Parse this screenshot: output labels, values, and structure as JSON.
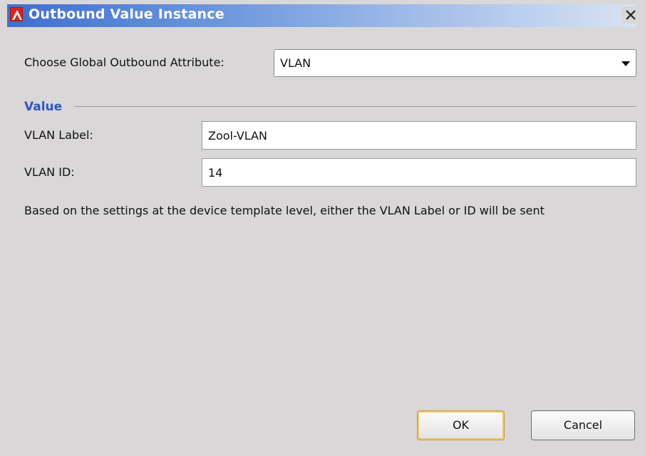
{
  "window": {
    "title": "Outbound Value Instance",
    "icon": "app-logo-icon",
    "close_icon": "close-icon"
  },
  "attribute": {
    "label": "Choose Global Outbound Attribute:",
    "selected": "VLAN",
    "arrow_icon": "chevron-down-icon"
  },
  "value_section": {
    "title": "Value",
    "vlan_label": {
      "label": "VLAN Label:",
      "value": "Zool-VLAN"
    },
    "vlan_id": {
      "label": "VLAN ID:",
      "value": "14"
    },
    "note": "Based on the settings at the device template level, either the VLAN Label or ID will be sent"
  },
  "buttons": {
    "ok": "OK",
    "cancel": "Cancel"
  },
  "colors": {
    "title_gradient_start": "#3e6fd0",
    "title_gradient_end": "#d8e3f3",
    "section_title": "#2f56c4",
    "app_icon": "#d8231f",
    "ok_border": "#c99a33"
  }
}
